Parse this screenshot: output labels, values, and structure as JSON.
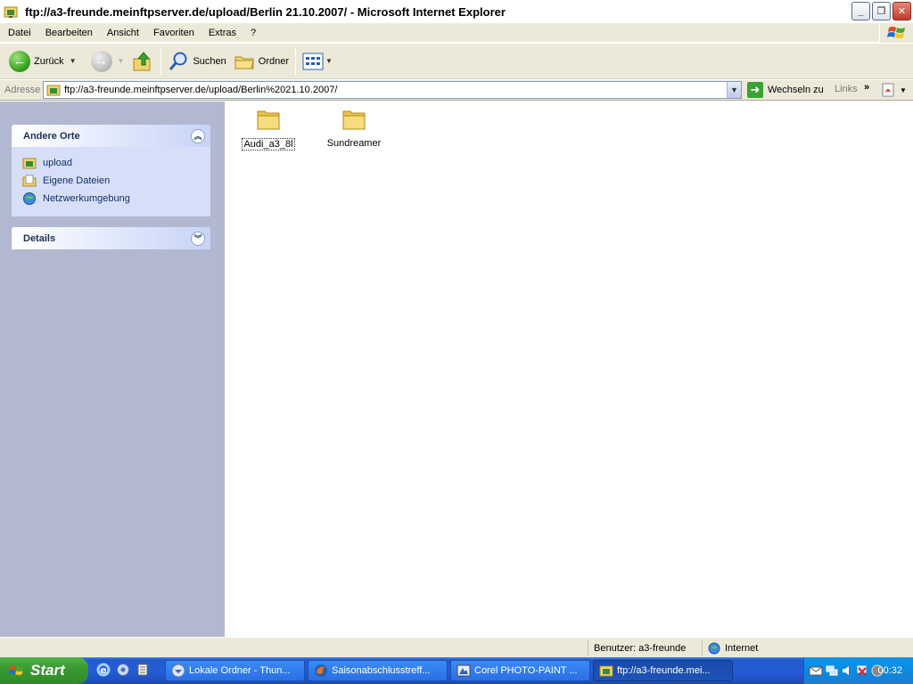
{
  "window": {
    "title": "ftp://a3-freunde.meinftpserver.de/upload/Berlin 21.10.2007/ - Microsoft Internet Explorer"
  },
  "menu": [
    "Datei",
    "Bearbeiten",
    "Ansicht",
    "Favoriten",
    "Extras",
    "?"
  ],
  "toolbar": {
    "back_label": "Zurück",
    "search_label": "Suchen",
    "folders_label": "Ordner"
  },
  "address": {
    "label": "Adresse",
    "value": "ftp://a3-freunde.meinftpserver.de/upload/Berlin%2021.10.2007/",
    "go_label": "Wechseln zu",
    "links_label": "Links"
  },
  "sidebar": {
    "other_places": {
      "title": "Andere Orte",
      "items": [
        {
          "label": "upload",
          "icon": "ftp-folder-icon"
        },
        {
          "label": "Eigene Dateien",
          "icon": "my-documents-icon"
        },
        {
          "label": "Netzwerkumgebung",
          "icon": "network-icon"
        }
      ]
    },
    "details": {
      "title": "Details"
    }
  },
  "folders": [
    {
      "name": "Audi_a3_8l",
      "selected": true
    },
    {
      "name": "Sundreamer",
      "selected": false
    }
  ],
  "status": {
    "user": "Benutzer: a3-freunde",
    "zone": "Internet"
  },
  "taskbar": {
    "start_label": "Start",
    "tasks": [
      {
        "label": "Lokale Ordner - Thun...",
        "active": false
      },
      {
        "label": "Saisonabschlusstreff...",
        "active": false
      },
      {
        "label": "Corel PHOTO-PAINT ...",
        "active": false
      },
      {
        "label": "ftp://a3-freunde.mei...",
        "active": true
      }
    ],
    "clock": "00:32"
  },
  "colors": {
    "taskbar_blue": "#245dd7",
    "start_green": "#3a9a32",
    "sidebar_bg": "#b2b8cf",
    "panel_body": "#d6dff7",
    "link_text": "#0f2f6b"
  }
}
